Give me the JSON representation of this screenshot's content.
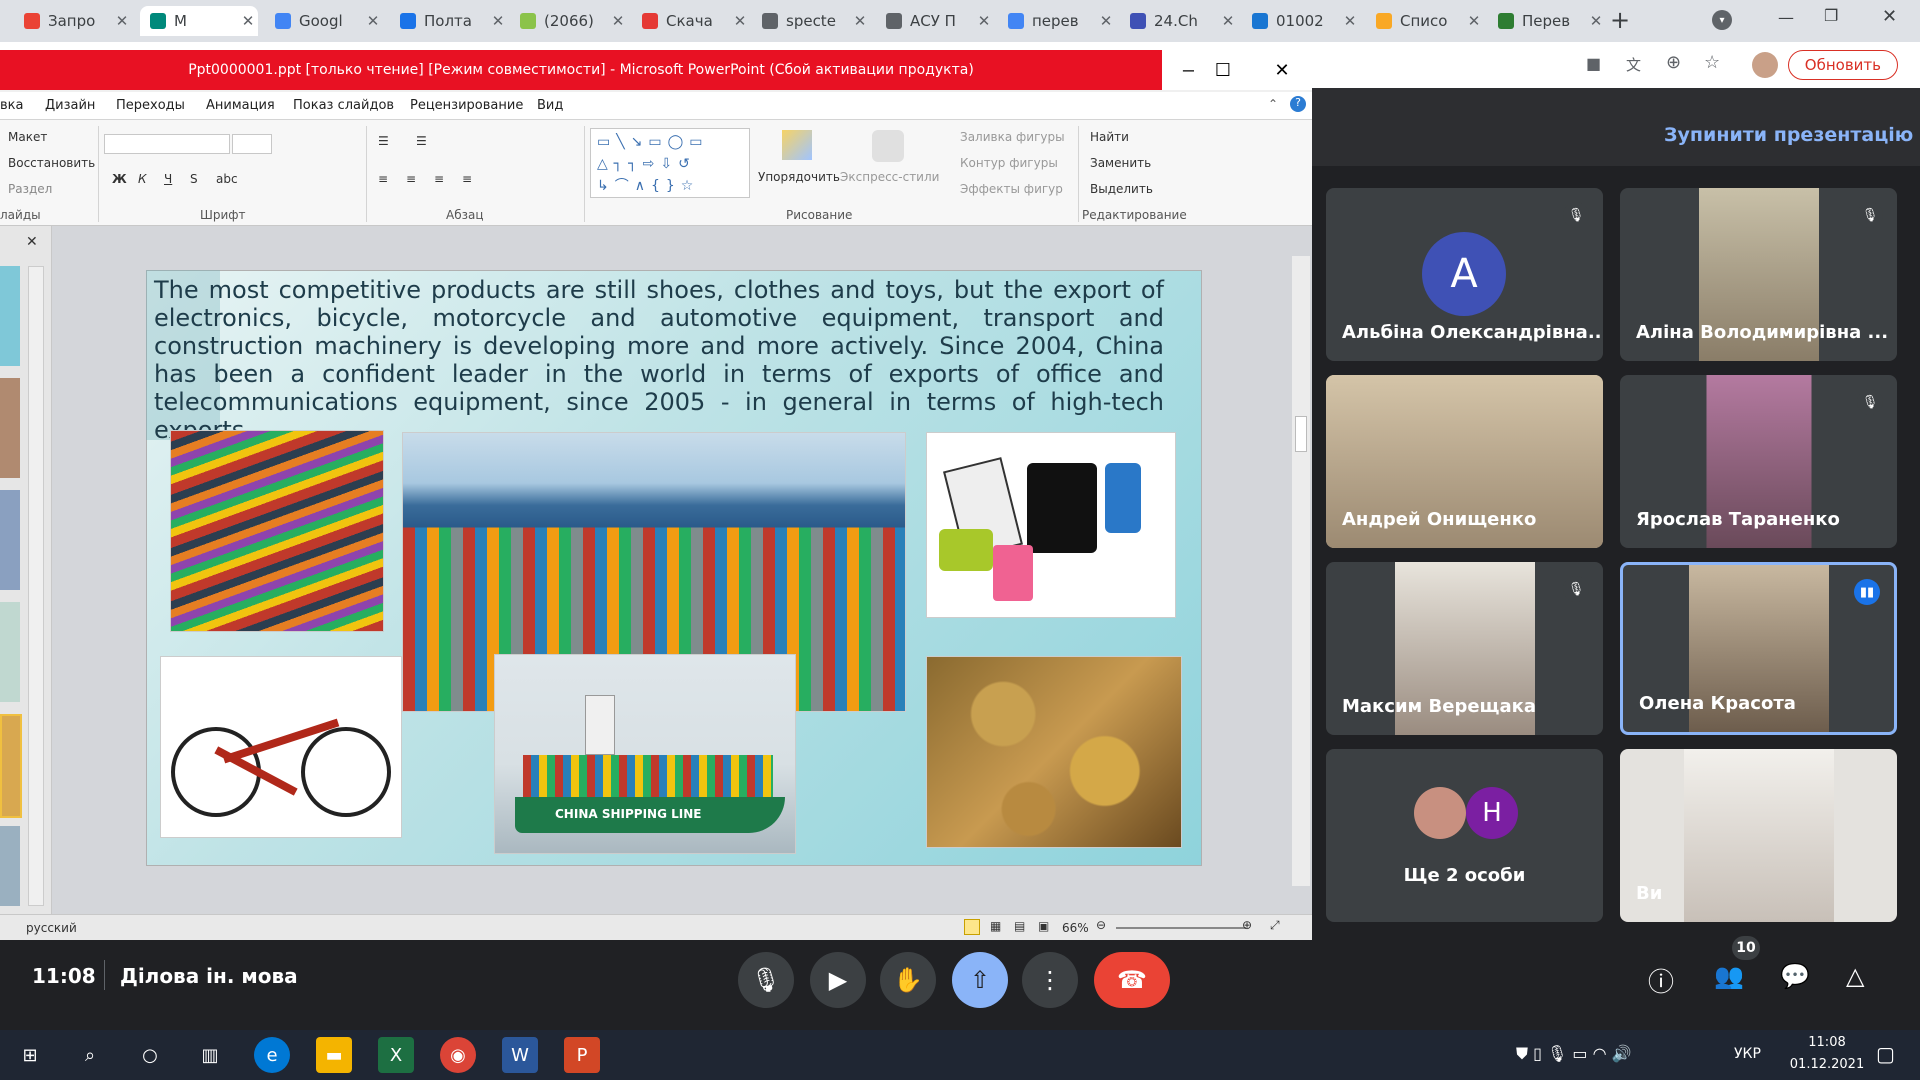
{
  "browser": {
    "tabs": [
      {
        "label": "Запро",
        "icon": "gmail-icon",
        "color": "#ea4335"
      },
      {
        "label": "M",
        "icon": "meet-icon",
        "color": "#00897b",
        "active": true
      },
      {
        "label": "Googl",
        "icon": "google-docs-icon",
        "color": "#4285f4"
      },
      {
        "label": "Полта",
        "icon": "calendar-icon",
        "color": "#1a73e8"
      },
      {
        "label": "(2066)",
        "icon": "shop-icon",
        "color": "#8bc34a"
      },
      {
        "label": "Скача",
        "icon": "heart-icon",
        "color": "#e53935"
      },
      {
        "label": "specte",
        "icon": "globe-icon",
        "color": "#5f6368"
      },
      {
        "label": "АСУ П",
        "icon": "globe-icon",
        "color": "#5f6368"
      },
      {
        "label": "перев",
        "icon": "google-icon",
        "color": "#4285f4"
      },
      {
        "label": "24.Ch",
        "icon": "bank-icon",
        "color": "#3f51b5"
      },
      {
        "label": "01002",
        "icon": "search-doc-icon",
        "color": "#1976d2"
      },
      {
        "label": "Списо",
        "icon": "pen-icon",
        "color": "#f9a825"
      },
      {
        "label": "Перев",
        "icon": "letter-b-icon",
        "color": "#2e7d32"
      }
    ],
    "update_label": "Обновить"
  },
  "ppt": {
    "title": "Ppt0000001.ppt [только чтение] [Режим совместимости] - Microsoft PowerPoint (Сбой активации продукта)",
    "menu": [
      "вка",
      "Дизайн",
      "Переходы",
      "Анимация",
      "Показ слайдов",
      "Рецензирование",
      "Вид"
    ],
    "ribbon": {
      "slides": [
        "Макет",
        "Восстановить",
        "Раздел"
      ],
      "slides_group": "лайды",
      "font_group": "Шрифт",
      "para_group": "Абзац",
      "arrange": "Упорядочить",
      "quick_styles": "Экспресс-стили",
      "fill": "Заливка фигуры",
      "outline": "Контур фигуры",
      "effects": "Эффекты фигур",
      "drawing_group": "Рисование",
      "find": "Найти",
      "replace": "Заменить",
      "select": "Выделить",
      "edit_group": "Редактирование"
    },
    "slide_text": "The most competitive products are still shoes, clothes and toys, but the export of electronics, bicycle, motorcycle and automotive equipment, transport and construction machinery is developing more and more actively. Since 2004, China has been a confident leader in the world in terms of exports of office and telecommunications equipment, since 2005 - in general in terms of high-tech exports.",
    "ship_label": "CHINA SHIPPING LINE",
    "status_lang": "русский",
    "zoom": "66%"
  },
  "meet": {
    "stop_presentation": "Зупинити презентацію",
    "participants": [
      {
        "name": "Альбіна Олександрівна...",
        "avatar_letter": "A",
        "muted": true
      },
      {
        "name": "Аліна Володимирівна ...",
        "muted": true
      },
      {
        "name": "Андрей Онищенко",
        "muted": false
      },
      {
        "name": "Ярослав Тараненко",
        "muted": true
      },
      {
        "name": "Максим Верещака",
        "muted": true
      },
      {
        "name": "Олена Красота",
        "speaking": true
      },
      {
        "name": "Ще 2 особи",
        "avatar_letter": "H"
      },
      {
        "name": "Ви"
      }
    ],
    "time": "11:08",
    "meeting_title": "Ділова ін. мова",
    "participant_count": "10"
  },
  "taskbar": {
    "lang": "УКР",
    "time": "11:08",
    "date": "01.12.2021"
  }
}
